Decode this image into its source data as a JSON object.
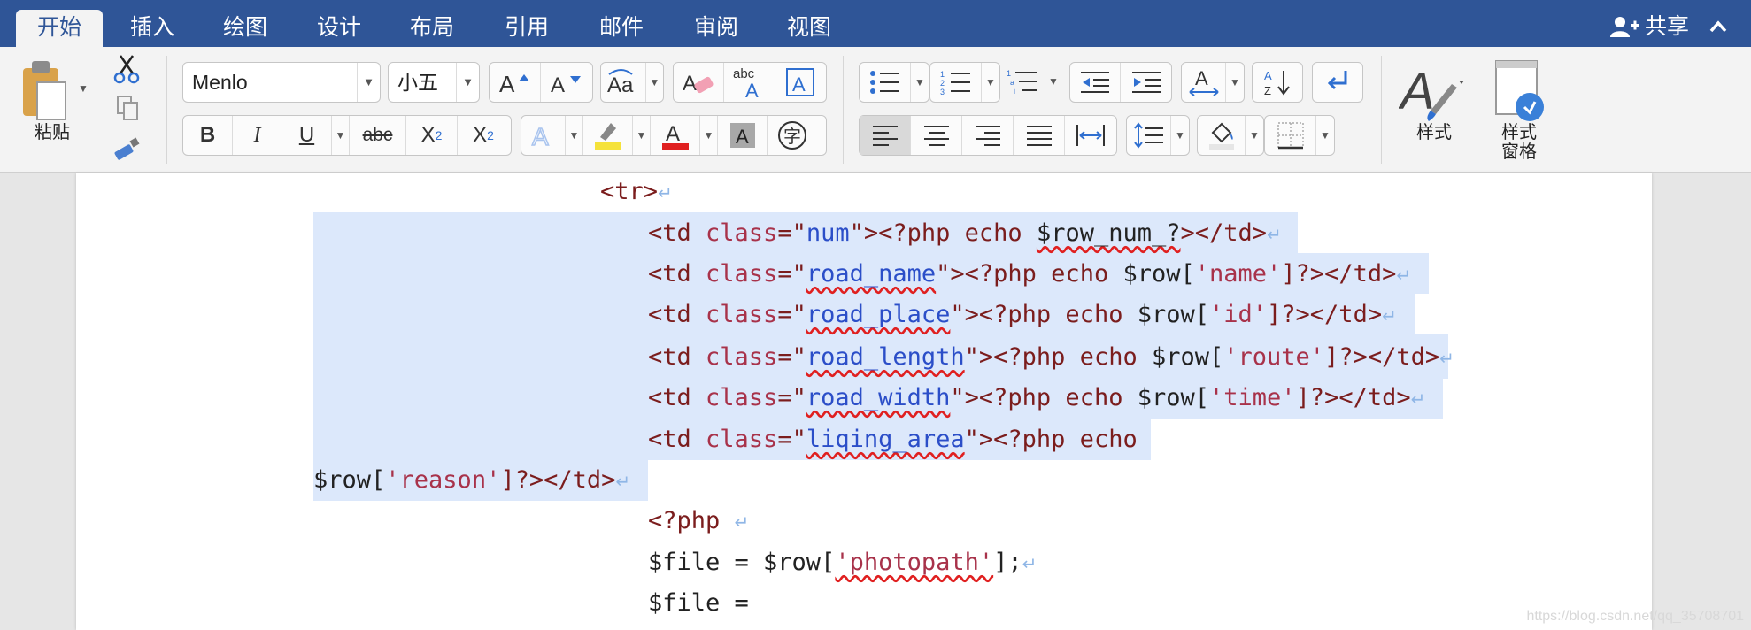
{
  "tabs": [
    {
      "label": "开始",
      "active": true
    },
    {
      "label": "插入"
    },
    {
      "label": "绘图"
    },
    {
      "label": "设计"
    },
    {
      "label": "布局"
    },
    {
      "label": "引用"
    },
    {
      "label": "邮件"
    },
    {
      "label": "审阅"
    },
    {
      "label": "视图"
    }
  ],
  "share_label": "共享",
  "ribbon": {
    "paste_label": "粘贴",
    "font_name": "Menlo",
    "font_size": "小五",
    "bold": "B",
    "italic": "I",
    "underline": "U",
    "strike": "abc",
    "subscript": "X",
    "superscript": "X",
    "styles_label": "样式",
    "styles_pane_label_1": "样式",
    "styles_pane_label_2": "窗格",
    "colors": {
      "highlight": "#f5e23b",
      "font_color": "#e02020",
      "accent": "#2f5597"
    }
  },
  "document": {
    "lines": [
      {
        "id": "tr",
        "parts": [
          {
            "t": "<tr>",
            "c": "tag"
          }
        ]
      },
      {
        "id": "td1",
        "parts": [
          {
            "t": "<td ",
            "c": "tag"
          },
          {
            "t": "class",
            "c": "kw"
          },
          {
            "t": "=\"",
            "c": "tag"
          },
          {
            "t": "num",
            "c": "str"
          },
          {
            "t": "\"><?php echo ",
            "c": "tag"
          },
          {
            "t": "$row_num_?",
            "c": "plain"
          },
          {
            "t": "></td>",
            "c": "tag"
          }
        ]
      },
      {
        "id": "td2",
        "parts": [
          {
            "t": "<td ",
            "c": "tag"
          },
          {
            "t": "class",
            "c": "kw"
          },
          {
            "t": "=\"",
            "c": "tag"
          },
          {
            "t": "road_name",
            "c": "str"
          },
          {
            "t": "\"><?php echo ",
            "c": "tag"
          },
          {
            "t": "$row[",
            "c": "plain"
          },
          {
            "t": "'name'",
            "c": "sq"
          },
          {
            "t": "]?></td>",
            "c": "tag"
          }
        ]
      },
      {
        "id": "td3",
        "parts": [
          {
            "t": "<td ",
            "c": "tag"
          },
          {
            "t": "class",
            "c": "kw"
          },
          {
            "t": "=\"",
            "c": "tag"
          },
          {
            "t": "road_place",
            "c": "str"
          },
          {
            "t": "\"><?php echo ",
            "c": "tag"
          },
          {
            "t": "$row[",
            "c": "plain"
          },
          {
            "t": "'id'",
            "c": "sq"
          },
          {
            "t": "]?></td>",
            "c": "tag"
          }
        ]
      },
      {
        "id": "td4",
        "parts": [
          {
            "t": "<td ",
            "c": "tag"
          },
          {
            "t": "class",
            "c": "kw"
          },
          {
            "t": "=\"",
            "c": "tag"
          },
          {
            "t": "road_length",
            "c": "str"
          },
          {
            "t": "\"><?php echo ",
            "c": "tag"
          },
          {
            "t": "$row[",
            "c": "plain"
          },
          {
            "t": "'route'",
            "c": "sq"
          },
          {
            "t": "]?></td>",
            "c": "tag"
          }
        ]
      },
      {
        "id": "td5",
        "parts": [
          {
            "t": "<td ",
            "c": "tag"
          },
          {
            "t": "class",
            "c": "kw"
          },
          {
            "t": "=\"",
            "c": "tag"
          },
          {
            "t": "road_width",
            "c": "str"
          },
          {
            "t": "\"><?php echo ",
            "c": "tag"
          },
          {
            "t": "$row[",
            "c": "plain"
          },
          {
            "t": "'time'",
            "c": "sq"
          },
          {
            "t": "]?></td>",
            "c": "tag"
          }
        ]
      },
      {
        "id": "td6",
        "parts": [
          {
            "t": "<td ",
            "c": "tag"
          },
          {
            "t": "class",
            "c": "kw"
          },
          {
            "t": "=\"",
            "c": "tag"
          },
          {
            "t": "liqing_area",
            "c": "str"
          },
          {
            "t": "\"><?php echo",
            "c": "tag"
          }
        ]
      },
      {
        "id": "td6b",
        "parts": [
          {
            "t": "$row[",
            "c": "plain"
          },
          {
            "t": "'reason'",
            "c": "sq"
          },
          {
            "t": "]?></td>",
            "c": "tag"
          }
        ]
      },
      {
        "id": "php",
        "parts": [
          {
            "t": "<?php ",
            "c": "tag"
          }
        ]
      },
      {
        "id": "file1",
        "parts": [
          {
            "t": "$file = $row[",
            "c": "plain"
          },
          {
            "t": "'photopath'",
            "c": "sq"
          },
          {
            "t": "];",
            "c": "plain"
          }
        ]
      },
      {
        "id": "file2",
        "parts": [
          {
            "t": "$file =",
            "c": "plain"
          }
        ]
      }
    ],
    "pilcrow": "↵",
    "watermark": "https://blog.csdn.net/qq_35708701"
  }
}
